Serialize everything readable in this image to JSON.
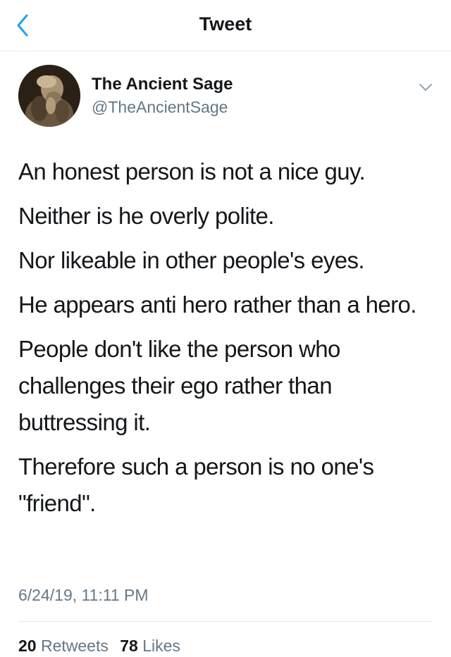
{
  "header": {
    "title": "Tweet",
    "back_icon": "chevron-left-icon",
    "accent_color": "#1da1f2"
  },
  "author": {
    "name": "The Ancient Sage",
    "handle": "@TheAncientSage",
    "menu_icon": "chevron-down-icon"
  },
  "tweet": {
    "paragraphs": [
      "An honest person is not a nice guy.",
      "Neither is he overly polite.",
      "Nor likeable in other people's eyes.",
      "He appears anti hero rather than a hero.",
      "People don't like the person who challenges their ego rather than buttressing it.",
      "Therefore such a person is no one's \"friend\"."
    ],
    "timestamp": "6/24/19, 11:11 PM"
  },
  "stats": {
    "retweets_count": "20",
    "retweets_label": "Retweets",
    "likes_count": "78",
    "likes_label": "Likes"
  }
}
